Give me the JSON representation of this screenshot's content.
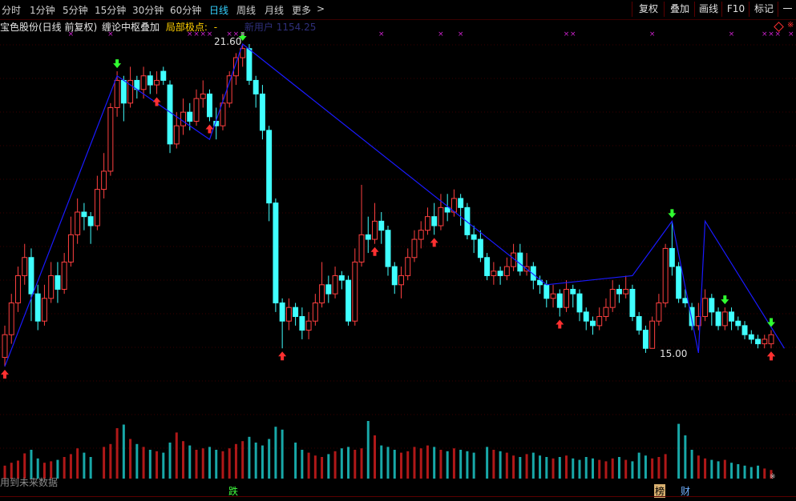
{
  "toolbar": {
    "periods": [
      "分时",
      "1分钟",
      "5分钟",
      "15分钟",
      "30分钟",
      "60分钟",
      "日线",
      "周线",
      "月线",
      "更多"
    ],
    "active_period": "日线",
    "more_arrow": ">",
    "buttons": [
      "复权",
      "叠加",
      "画线",
      "F10",
      "标记",
      "一自"
    ]
  },
  "info": {
    "title": "宝色股份(日线 前复权)",
    "indicator": "缠论中枢叠加",
    "extreme_label": "局部极点:",
    "extreme_value": "-",
    "faded_text": "新用户 1154.25"
  },
  "annotations": {
    "high_price": "21.60",
    "low_price": "15.00",
    "event_down": "跌",
    "event_list": "榜",
    "event_fin": "财",
    "side_marker": "※"
  },
  "bottom": {
    "watermark": "用到未来数据"
  },
  "colors": {
    "up": "#ff4040",
    "down": "#40ffff",
    "stroke": "#1a1aff",
    "grid": "#3a0000",
    "up_arrow": "#ff3030",
    "down_arrow": "#30ff30",
    "cross": "#cc22cc"
  },
  "chart_data": {
    "type": "candlestick",
    "price_range": [
      14.0,
      22.0
    ],
    "candles": [
      {
        "o": 14.8,
        "c": 15.3,
        "h": 15.5,
        "l": 14.6
      },
      {
        "o": 15.3,
        "c": 16.0,
        "h": 16.2,
        "l": 15.1
      },
      {
        "o": 16.0,
        "c": 16.6,
        "h": 16.8,
        "l": 15.8
      },
      {
        "o": 16.6,
        "c": 17.0,
        "h": 17.3,
        "l": 16.4
      },
      {
        "o": 17.0,
        "c": 16.2,
        "h": 17.2,
        "l": 15.6
      },
      {
        "o": 16.2,
        "c": 15.6,
        "h": 16.4,
        "l": 15.4
      },
      {
        "o": 15.6,
        "c": 16.1,
        "h": 16.4,
        "l": 15.5
      },
      {
        "o": 16.1,
        "c": 16.6,
        "h": 16.9,
        "l": 16.0
      },
      {
        "o": 16.6,
        "c": 16.3,
        "h": 16.9,
        "l": 16.0
      },
      {
        "o": 16.3,
        "c": 16.9,
        "h": 17.1,
        "l": 16.2
      },
      {
        "o": 16.9,
        "c": 17.5,
        "h": 17.9,
        "l": 16.8
      },
      {
        "o": 17.5,
        "c": 18.0,
        "h": 18.3,
        "l": 17.3
      },
      {
        "o": 18.0,
        "c": 17.9,
        "h": 18.2,
        "l": 17.6
      },
      {
        "o": 17.9,
        "c": 17.7,
        "h": 18.0,
        "l": 17.3
      },
      {
        "o": 17.7,
        "c": 18.5,
        "h": 18.8,
        "l": 17.6
      },
      {
        "o": 18.5,
        "c": 18.9,
        "h": 19.3,
        "l": 18.3
      },
      {
        "o": 18.9,
        "c": 20.3,
        "h": 20.4,
        "l": 18.8
      },
      {
        "o": 20.3,
        "c": 20.9,
        "h": 21.1,
        "l": 20.1
      },
      {
        "o": 20.9,
        "c": 20.4,
        "h": 21.0,
        "l": 20.0
      },
      {
        "o": 20.4,
        "c": 20.9,
        "h": 21.2,
        "l": 20.3
      },
      {
        "o": 20.9,
        "c": 20.7,
        "h": 21.0,
        "l": 20.5
      },
      {
        "o": 20.7,
        "c": 21.0,
        "h": 21.2,
        "l": 20.5
      },
      {
        "o": 21.0,
        "c": 20.8,
        "h": 21.1,
        "l": 20.6
      },
      {
        "o": 20.8,
        "c": 20.9,
        "h": 21.1,
        "l": 20.6
      },
      {
        "o": 21.1,
        "c": 20.9,
        "h": 21.2,
        "l": 20.8
      },
      {
        "o": 20.8,
        "c": 19.5,
        "h": 20.9,
        "l": 19.3
      },
      {
        "o": 19.5,
        "c": 19.9,
        "h": 20.2,
        "l": 19.4
      },
      {
        "o": 19.9,
        "c": 20.2,
        "h": 20.5,
        "l": 19.7
      },
      {
        "o": 20.2,
        "c": 20.0,
        "h": 20.4,
        "l": 19.8
      },
      {
        "o": 20.0,
        "c": 20.5,
        "h": 20.7,
        "l": 19.9
      },
      {
        "o": 20.5,
        "c": 20.6,
        "h": 20.9,
        "l": 20.3
      },
      {
        "o": 20.6,
        "c": 20.1,
        "h": 20.7,
        "l": 20.0
      },
      {
        "o": 20.0,
        "c": 19.9,
        "h": 20.3,
        "l": 19.6
      },
      {
        "o": 19.9,
        "c": 20.4,
        "h": 20.6,
        "l": 19.8
      },
      {
        "o": 20.4,
        "c": 21.0,
        "h": 21.1,
        "l": 20.3
      },
      {
        "o": 21.0,
        "c": 21.4,
        "h": 21.5,
        "l": 20.8
      },
      {
        "o": 21.4,
        "c": 21.6,
        "h": 21.7,
        "l": 21.2
      },
      {
        "o": 21.6,
        "c": 20.9,
        "h": 21.7,
        "l": 20.8
      },
      {
        "o": 20.9,
        "c": 20.6,
        "h": 21.0,
        "l": 20.3
      },
      {
        "o": 20.6,
        "c": 19.8,
        "h": 20.8,
        "l": 19.6
      },
      {
        "o": 19.8,
        "c": 18.2,
        "h": 19.9,
        "l": 17.8
      },
      {
        "o": 18.2,
        "c": 16.0,
        "h": 18.3,
        "l": 15.8
      },
      {
        "o": 16.0,
        "c": 15.6,
        "h": 16.1,
        "l": 15.0
      },
      {
        "o": 15.6,
        "c": 15.9,
        "h": 16.1,
        "l": 15.4
      },
      {
        "o": 15.9,
        "c": 15.7,
        "h": 16.0,
        "l": 15.5
      },
      {
        "o": 15.7,
        "c": 15.4,
        "h": 15.9,
        "l": 15.2
      },
      {
        "o": 15.4,
        "c": 15.6,
        "h": 15.8,
        "l": 15.2
      },
      {
        "o": 15.6,
        "c": 16.0,
        "h": 16.2,
        "l": 15.5
      },
      {
        "o": 16.0,
        "c": 16.4,
        "h": 16.9,
        "l": 15.9
      },
      {
        "o": 16.4,
        "c": 16.2,
        "h": 16.6,
        "l": 16.0
      },
      {
        "o": 16.2,
        "c": 16.6,
        "h": 16.8,
        "l": 16.1
      },
      {
        "o": 16.6,
        "c": 16.5,
        "h": 16.7,
        "l": 16.3
      },
      {
        "o": 16.5,
        "c": 15.6,
        "h": 16.6,
        "l": 15.5
      },
      {
        "o": 15.6,
        "c": 16.9,
        "h": 17.2,
        "l": 15.5
      },
      {
        "o": 16.9,
        "c": 17.5,
        "h": 18.6,
        "l": 16.8
      },
      {
        "o": 17.5,
        "c": 17.4,
        "h": 17.9,
        "l": 17.1
      },
      {
        "o": 17.4,
        "c": 17.8,
        "h": 18.2,
        "l": 17.3
      },
      {
        "o": 17.8,
        "c": 17.6,
        "h": 18.0,
        "l": 17.3
      },
      {
        "o": 17.6,
        "c": 16.8,
        "h": 17.7,
        "l": 16.6
      },
      {
        "o": 16.8,
        "c": 16.4,
        "h": 16.9,
        "l": 16.2
      },
      {
        "o": 16.4,
        "c": 16.6,
        "h": 16.8,
        "l": 16.1
      },
      {
        "o": 16.6,
        "c": 17.0,
        "h": 17.2,
        "l": 16.5
      },
      {
        "o": 17.0,
        "c": 17.4,
        "h": 17.6,
        "l": 16.9
      },
      {
        "o": 17.4,
        "c": 17.6,
        "h": 17.8,
        "l": 17.2
      },
      {
        "o": 17.6,
        "c": 17.9,
        "h": 18.1,
        "l": 17.5
      },
      {
        "o": 17.9,
        "c": 17.7,
        "h": 18.2,
        "l": 17.5
      },
      {
        "o": 17.7,
        "c": 18.1,
        "h": 18.4,
        "l": 17.6
      },
      {
        "o": 18.1,
        "c": 18.0,
        "h": 18.4,
        "l": 17.8
      },
      {
        "o": 18.0,
        "c": 18.3,
        "h": 18.5,
        "l": 17.9
      },
      {
        "o": 18.3,
        "c": 18.1,
        "h": 18.4,
        "l": 17.7
      },
      {
        "o": 18.1,
        "c": 17.5,
        "h": 18.2,
        "l": 17.4
      },
      {
        "o": 17.5,
        "c": 17.4,
        "h": 17.7,
        "l": 17.1
      },
      {
        "o": 17.4,
        "c": 17.0,
        "h": 17.6,
        "l": 16.9
      },
      {
        "o": 17.0,
        "c": 16.6,
        "h": 17.1,
        "l": 16.5
      },
      {
        "o": 16.6,
        "c": 16.7,
        "h": 16.9,
        "l": 16.4
      },
      {
        "o": 16.7,
        "c": 16.6,
        "h": 16.8,
        "l": 16.4
      },
      {
        "o": 16.6,
        "c": 16.8,
        "h": 17.0,
        "l": 16.5
      },
      {
        "o": 16.8,
        "c": 17.1,
        "h": 17.3,
        "l": 16.7
      },
      {
        "o": 17.1,
        "c": 16.7,
        "h": 17.3,
        "l": 16.6
      },
      {
        "o": 16.7,
        "c": 16.8,
        "h": 17.1,
        "l": 16.6
      },
      {
        "o": 16.8,
        "c": 16.5,
        "h": 16.9,
        "l": 16.3
      },
      {
        "o": 16.5,
        "c": 16.4,
        "h": 16.6,
        "l": 16.2
      },
      {
        "o": 16.4,
        "c": 16.1,
        "h": 16.5,
        "l": 15.9
      },
      {
        "o": 16.1,
        "c": 16.2,
        "h": 16.4,
        "l": 15.9
      },
      {
        "o": 16.2,
        "c": 15.9,
        "h": 16.3,
        "l": 15.7
      },
      {
        "o": 15.9,
        "c": 16.3,
        "h": 16.5,
        "l": 15.8
      },
      {
        "o": 16.3,
        "c": 16.2,
        "h": 16.4,
        "l": 15.9
      },
      {
        "o": 16.2,
        "c": 15.8,
        "h": 16.3,
        "l": 15.6
      },
      {
        "o": 15.8,
        "c": 15.6,
        "h": 15.9,
        "l": 15.4
      },
      {
        "o": 15.6,
        "c": 15.5,
        "h": 15.7,
        "l": 15.3
      },
      {
        "o": 15.5,
        "c": 15.7,
        "h": 15.9,
        "l": 15.4
      },
      {
        "o": 15.7,
        "c": 15.9,
        "h": 16.1,
        "l": 15.6
      },
      {
        "o": 15.9,
        "c": 16.3,
        "h": 16.5,
        "l": 15.8
      },
      {
        "o": 16.3,
        "c": 16.2,
        "h": 16.4,
        "l": 16.0
      },
      {
        "o": 16.2,
        "c": 16.3,
        "h": 16.6,
        "l": 16.1
      },
      {
        "o": 16.3,
        "c": 15.7,
        "h": 16.4,
        "l": 15.6
      },
      {
        "o": 15.7,
        "c": 15.4,
        "h": 15.8,
        "l": 15.3
      },
      {
        "o": 15.4,
        "c": 15.0,
        "h": 15.5,
        "l": 14.9
      },
      {
        "o": 15.0,
        "c": 15.6,
        "h": 15.7,
        "l": 15.0
      },
      {
        "o": 15.6,
        "c": 16.0,
        "h": 16.2,
        "l": 15.5
      },
      {
        "o": 16.0,
        "c": 17.2,
        "h": 17.3,
        "l": 15.9
      },
      {
        "o": 17.2,
        "c": 16.8,
        "h": 17.8,
        "l": 16.6
      },
      {
        "o": 16.8,
        "c": 16.1,
        "h": 16.9,
        "l": 16.0
      },
      {
        "o": 16.1,
        "c": 16.0,
        "h": 16.3,
        "l": 15.9
      },
      {
        "o": 15.9,
        "c": 15.5,
        "h": 16.0,
        "l": 15.4
      },
      {
        "o": 15.5,
        "c": 15.7,
        "h": 16.0,
        "l": 15.4
      },
      {
        "o": 15.7,
        "c": 16.1,
        "h": 16.3,
        "l": 15.6
      },
      {
        "o": 16.1,
        "c": 15.8,
        "h": 16.2,
        "l": 15.5
      },
      {
        "o": 15.8,
        "c": 15.5,
        "h": 15.9,
        "l": 15.4
      },
      {
        "o": 15.5,
        "c": 15.8,
        "h": 15.9,
        "l": 15.4
      },
      {
        "o": 15.8,
        "c": 15.6,
        "h": 15.9,
        "l": 15.4
      },
      {
        "o": 15.6,
        "c": 15.5,
        "h": 15.7,
        "l": 15.4
      },
      {
        "o": 15.5,
        "c": 15.3,
        "h": 15.6,
        "l": 15.2
      },
      {
        "o": 15.3,
        "c": 15.2,
        "h": 15.4,
        "l": 15.1
      },
      {
        "o": 15.2,
        "c": 15.1,
        "h": 15.3,
        "l": 15.0
      },
      {
        "o": 15.1,
        "c": 15.2,
        "h": 15.3,
        "l": 15.0
      },
      {
        "o": 15.1,
        "c": 15.3,
        "h": 15.4,
        "l": 15.0
      }
    ],
    "stroke_points": [
      [
        0,
        14.6
      ],
      [
        17,
        21.0
      ],
      [
        31,
        19.6
      ],
      [
        36,
        21.7
      ],
      [
        82,
        16.4
      ],
      [
        95,
        16.6
      ],
      [
        101,
        17.8
      ],
      [
        105,
        14.9
      ],
      [
        106,
        17.8
      ],
      [
        118,
        15.0
      ]
    ],
    "markers": [
      {
        "i": 0,
        "type": "up"
      },
      {
        "i": 17,
        "type": "down"
      },
      {
        "i": 23,
        "type": "up"
      },
      {
        "i": 31,
        "type": "up"
      },
      {
        "i": 36,
        "type": "down"
      },
      {
        "i": 42,
        "type": "up"
      },
      {
        "i": 56,
        "type": "up"
      },
      {
        "i": 65,
        "type": "up"
      },
      {
        "i": 84,
        "type": "up"
      },
      {
        "i": 101,
        "type": "down"
      },
      {
        "i": 109,
        "type": "down"
      },
      {
        "i": 116,
        "type": "up"
      },
      {
        "i": 120,
        "type": "down"
      },
      {
        "i": 136,
        "type": "up"
      }
    ],
    "volumes": [
      18,
      22,
      25,
      35,
      40,
      28,
      22,
      24,
      26,
      30,
      34,
      42,
      36,
      30,
      44,
      48,
      70,
      75,
      55,
      48,
      44,
      40,
      38,
      36,
      50,
      64,
      52,
      46,
      40,
      42,
      44,
      40,
      38,
      42,
      48,
      52,
      58,
      50,
      46,
      55,
      72,
      68,
      50,
      40,
      36,
      32,
      30,
      34,
      38,
      42,
      44,
      40,
      42,
      80,
      60,
      46,
      44,
      40,
      36,
      38,
      44,
      42,
      46,
      44,
      40,
      38,
      42,
      40,
      38,
      36,
      44,
      40,
      38,
      36,
      32,
      30,
      34,
      36,
      32,
      30,
      28,
      30,
      32,
      28,
      26,
      30,
      28,
      26,
      24,
      28,
      30,
      26,
      24,
      36,
      32,
      28,
      30,
      34,
      76,
      60,
      40,
      32,
      28,
      26,
      24,
      26,
      22,
      20,
      18,
      16,
      18,
      14,
      12
    ]
  }
}
